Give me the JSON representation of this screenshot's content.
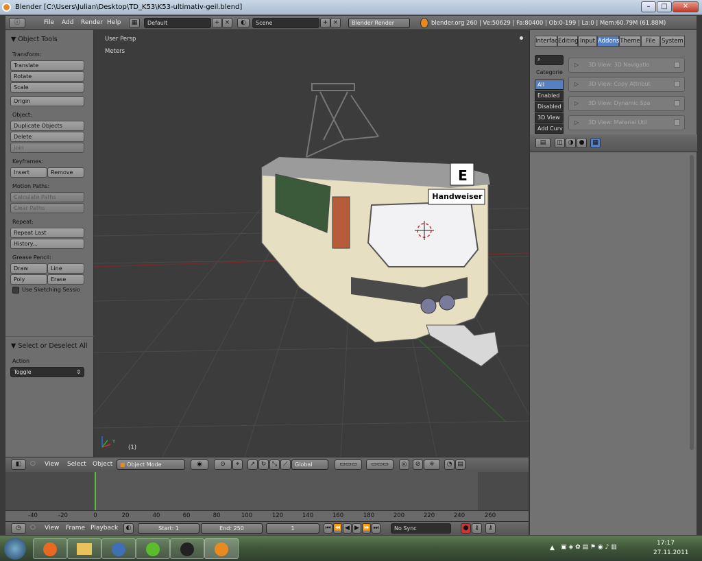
{
  "window": {
    "title": "Blender [C:\\Users\\Julian\\Desktop\\TD_K53\\K53-ultimativ-geil.blend]",
    "min": "–",
    "max": "□",
    "close": "✕"
  },
  "mainbar": {
    "menus": [
      "File",
      "Add",
      "Render",
      "Help"
    ],
    "layout": "Default",
    "scene": "Scene",
    "engine": "Blender Render",
    "info": "blender.org 260 | Ve:50629 | Fa:80400 | Ob:0-199 | La:0 | Mem:60.79M (61.88M)"
  },
  "toolshelf": {
    "title": "Object Tools",
    "transform": {
      "label": "Transform:",
      "translate": "Translate",
      "rotate": "Rotate",
      "scale": "Scale"
    },
    "origin": "Origin",
    "object": {
      "label": "Object:",
      "duplicate": "Duplicate Objects",
      "delete": "Delete",
      "join": "Join"
    },
    "keyframes": {
      "label": "Keyframes:",
      "insert": "Insert",
      "remove": "Remove"
    },
    "motion": {
      "label": "Motion Paths:",
      "calc": "Calculate Paths",
      "clear": "Clear Paths"
    },
    "repeat": {
      "label": "Repeat:",
      "last": "Repeat Last",
      "history": "History..."
    },
    "grease": {
      "label": "Grease Pencil:",
      "draw": "Draw",
      "line": "Line",
      "poly": "Poly",
      "erase": "Erase",
      "sketch": "Use Sketching Sessio"
    },
    "op": {
      "title": "Select or Deselect All",
      "action_label": "Action",
      "action_value": "Toggle"
    }
  },
  "viewport": {
    "view_name": "User Persp",
    "units": "Meters",
    "frame": "(1)",
    "sign_letter": "E",
    "sign_dest": "Handweiser",
    "axis_x": "X",
    "axis_y": "Y"
  },
  "v3dheader": {
    "view": "View",
    "select": "Select",
    "object": "Object",
    "mode": "Object Mode",
    "orientation": "Global"
  },
  "timeline": {
    "ticks": [
      "-40",
      "-20",
      "0",
      "20",
      "40",
      "60",
      "80",
      "100",
      "120",
      "140",
      "160",
      "180",
      "200",
      "220",
      "240",
      "260"
    ],
    "menus": {
      "view": "View",
      "frame": "Frame",
      "playback": "Playback"
    },
    "start": "Start: 1",
    "end": "End: 250",
    "current": "1",
    "sync": "No Sync"
  },
  "prefs": {
    "tabs": [
      "Interface",
      "Editing",
      "Input",
      "Addons",
      "Theme",
      "File",
      "System"
    ],
    "active_tab": "Addons",
    "categories_label": "Categorie",
    "categories": [
      "All",
      "Enabled",
      "Disabled",
      "3D View",
      "Add Curv"
    ],
    "addons": [
      "3D View: 3D Navigatio",
      "3D View: Copy Attribut",
      "3D View: Dynamic Spa",
      "3D View: Material Util"
    ]
  },
  "taskbar": {
    "time": "17:17",
    "date": "27.11.2011"
  },
  "colors": {
    "accent": "#5680c2",
    "grid_x": "#8a2a2a",
    "grid_y": "#3a7a3a",
    "tram_body": "#e7dfc2",
    "tram_roof": "#9b9b9b"
  }
}
